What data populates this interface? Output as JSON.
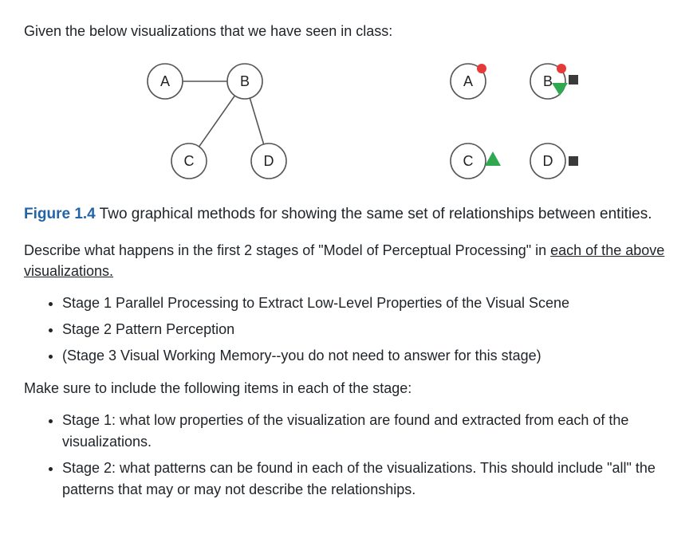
{
  "intro": "Given the below visualizations that we have seen in class:",
  "figure": {
    "label": "Figure 1.4",
    "caption_rest": " Two graphical methods for showing the same set of relationships between entities.",
    "nodes": {
      "A": "A",
      "B": "B",
      "C": "C",
      "D": "D"
    }
  },
  "instruction_part1": "Describe what happens in the first 2 stages of \"Model of Perceptual Processing\" in ",
  "instruction_underlined": "each of the above visualizations.",
  "stages": {
    "s1": "Stage 1 Parallel Processing to Extract Low-Level Properties of the Visual Scene",
    "s2": "Stage 2 Pattern Perception",
    "s3": "(Stage 3 Visual Working Memory--you do not need to answer for this stage)"
  },
  "requirements_intro": "Make sure to include the following items in each of the stage:",
  "requirements": {
    "r1": "Stage 1: what low properties of the visualization are found and extracted from each of the visualizations.",
    "r2": "Stage 2: what patterns can be found in each of the visualizations. This should include \"all\" the patterns that may or may not describe the relationships."
  },
  "colors": {
    "figure_label": "#2563a8",
    "node_stroke": "#555555",
    "marker_red": "#e63939",
    "marker_green": "#2fa84f",
    "marker_dark": "#3a3a3a"
  }
}
